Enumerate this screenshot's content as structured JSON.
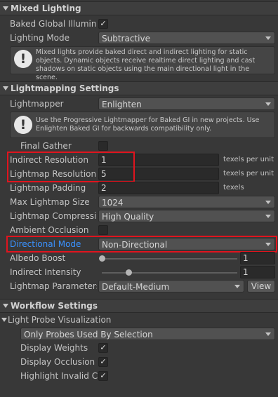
{
  "mixed_lighting": {
    "title": "Mixed Lighting",
    "baked_gi_label": "Baked Global Illuminat",
    "baked_gi_checked": "✓",
    "lighting_mode_label": "Lighting Mode",
    "lighting_mode_value": "Subtractive",
    "help_text": "Mixed lights provide baked direct and indirect lighting for static objects. Dynamic objects receive realtime direct lighting and cast shadows on static objects using the main directional light in the scene."
  },
  "lightmapping": {
    "title": "Lightmapping Settings",
    "lightmapper_label": "Lightmapper",
    "lightmapper_value": "Enlighten",
    "help_text": "Use the Progressive Lightmapper for Baked GI in new projects. Use Enlighten Baked GI for backwards compatibility only.",
    "final_gather_label": "Final Gather",
    "indirect_res_label": "Indirect Resolution",
    "indirect_res_value": "1",
    "indirect_res_unit": "texels per unit",
    "lightmap_res_label": "Lightmap Resolution",
    "lightmap_res_value": "5",
    "lightmap_res_unit": "texels per unit",
    "padding_label": "Lightmap Padding",
    "padding_value": "2",
    "padding_unit": "texels",
    "max_size_label": "Max Lightmap Size",
    "max_size_value": "1024",
    "compression_label": "Lightmap Compressior",
    "compression_value": "High Quality",
    "ao_label": "Ambient Occlusion",
    "directional_label": "Directional Mode",
    "directional_value": "Non-Directional",
    "albedo_label": "Albedo Boost",
    "albedo_value": "1",
    "indirect_intensity_label": "Indirect Intensity",
    "indirect_intensity_value": "1",
    "params_label": "Lightmap Parameters",
    "params_value": "Default-Medium",
    "view_label": "View"
  },
  "workflow": {
    "title": "Workflow Settings",
    "probe_vis_label": "Light Probe Visualization",
    "probe_mode_value": "Only Probes Used By Selection",
    "display_weights_label": "Display Weights",
    "display_weights_checked": "✓",
    "display_occlusion_label": "Display Occlusion",
    "display_occlusion_checked": "✓",
    "highlight_invalid_label": "Highlight Invalid Ce",
    "highlight_invalid_checked": "✓"
  },
  "colors": {
    "highlight_red": "#e0141e",
    "link_blue": "#3a92ff",
    "background": "#383838"
  }
}
